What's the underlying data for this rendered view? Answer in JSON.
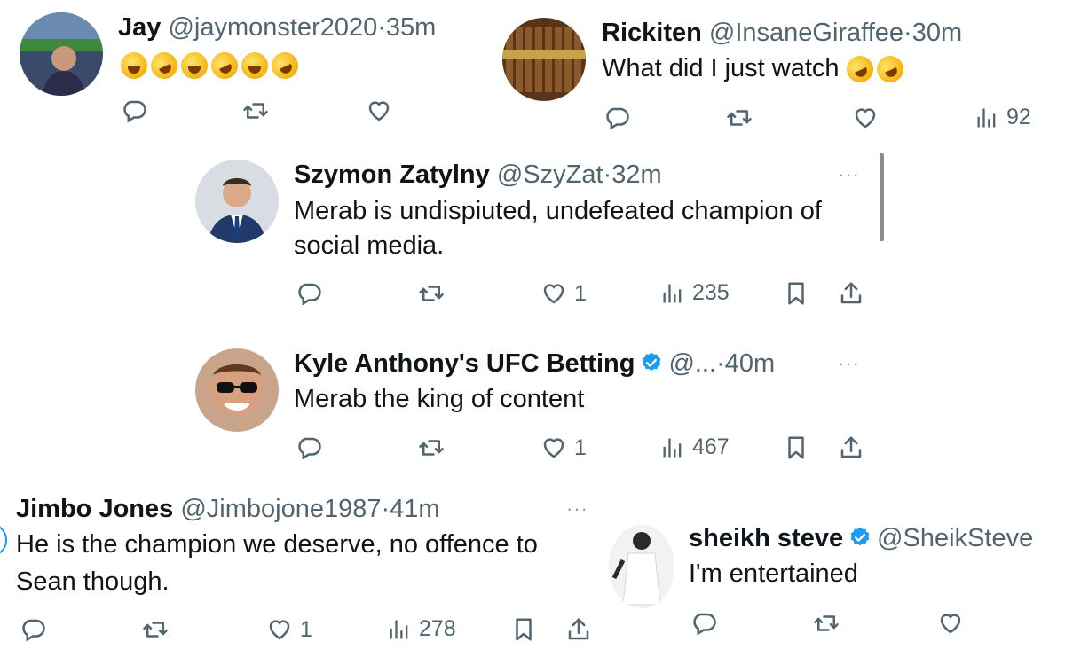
{
  "tweets": [
    {
      "name": "Jay",
      "handle": "@jaymonster2020",
      "sep": "·",
      "time": "35m",
      "emojis": [
        "face-with-tears-of-joy",
        "rolling-on-floor-laughing",
        "face-with-tears-of-joy",
        "rolling-on-floor-laughing",
        "face-with-tears-of-joy",
        "rolling-on-floor-laughing"
      ]
    },
    {
      "name": "Rickiten",
      "handle": "@InsaneGiraffee",
      "sep": "·",
      "time": "30m",
      "text": "What did I just watch",
      "emojis": [
        "rolling-on-floor-laughing",
        "rolling-on-floor-laughing"
      ],
      "views": "92"
    },
    {
      "name": "Szymon Zatylny",
      "handle": "@SzyZat",
      "sep": "·",
      "time": "32m",
      "text_line1": "Merab is undispiuted, undefeated champion of",
      "text_line2": "social media.",
      "likes": "1",
      "views": "235"
    },
    {
      "name": "Kyle Anthony's UFC Betting",
      "verified": true,
      "handle": "@...",
      "sep": "·",
      "time": "40m",
      "text": "Merab the king of content",
      "likes": "1",
      "views": "467"
    },
    {
      "name": "Jimbo Jones",
      "handle": "@Jimbojone1987",
      "sep": "·",
      "time": "41m",
      "text_line1": "He is the champion we deserve, no offence to",
      "text_line2": "Sean though.",
      "likes": "1",
      "views": "278"
    },
    {
      "name": "sheikh steve",
      "verified": true,
      "handle": "@SheikSteve",
      "text": "I'm entertained"
    }
  ],
  "more_glyph": "···",
  "colors": {
    "text": "#0f1419",
    "secondary": "#536471",
    "verified": "#1d9bf0"
  }
}
